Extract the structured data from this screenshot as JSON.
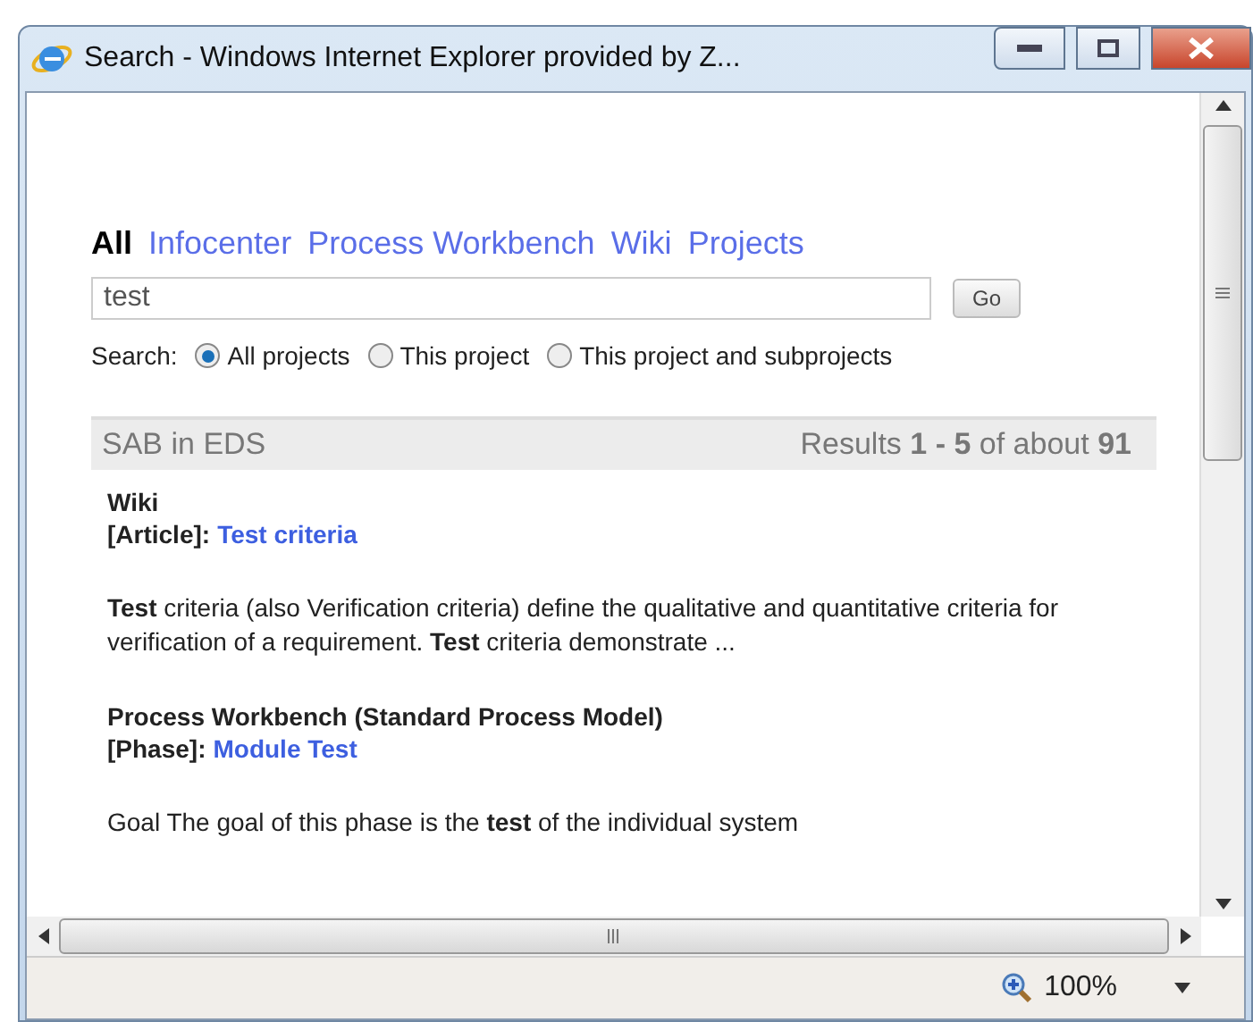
{
  "window": {
    "title": "Search - Windows Internet Explorer provided by Z..."
  },
  "tabs": [
    {
      "label": "All",
      "selected": true
    },
    {
      "label": "Infocenter",
      "selected": false
    },
    {
      "label": "Process Workbench",
      "selected": false
    },
    {
      "label": "Wiki",
      "selected": false
    },
    {
      "label": "Projects",
      "selected": false
    }
  ],
  "search": {
    "value": "test",
    "button": "Go"
  },
  "scope": {
    "label": "Search:",
    "options": [
      {
        "label": "All projects",
        "selected": true
      },
      {
        "label": "This project",
        "selected": false
      },
      {
        "label": "This project and subprojects",
        "selected": false
      }
    ]
  },
  "results_header": {
    "project": "SAB in EDS",
    "summary": "Results **1 - 5** of about **91**"
  },
  "results": [
    {
      "source": "Wiki",
      "type": "[Article]:",
      "link": "Test criteria",
      "snippet": "**Test** criteria (also Verification criteria) define the qualitative and quantitative criteria for verification of a requirement. **Test** criteria demonstrate ..."
    },
    {
      "source": "Process Workbench (Standard Process Model)",
      "type": "[Phase]:",
      "link": "Module Test",
      "snippet": "Goal The goal of this phase is the **test** of the individual system"
    }
  ],
  "status_bar": {
    "zoom": "100%"
  }
}
